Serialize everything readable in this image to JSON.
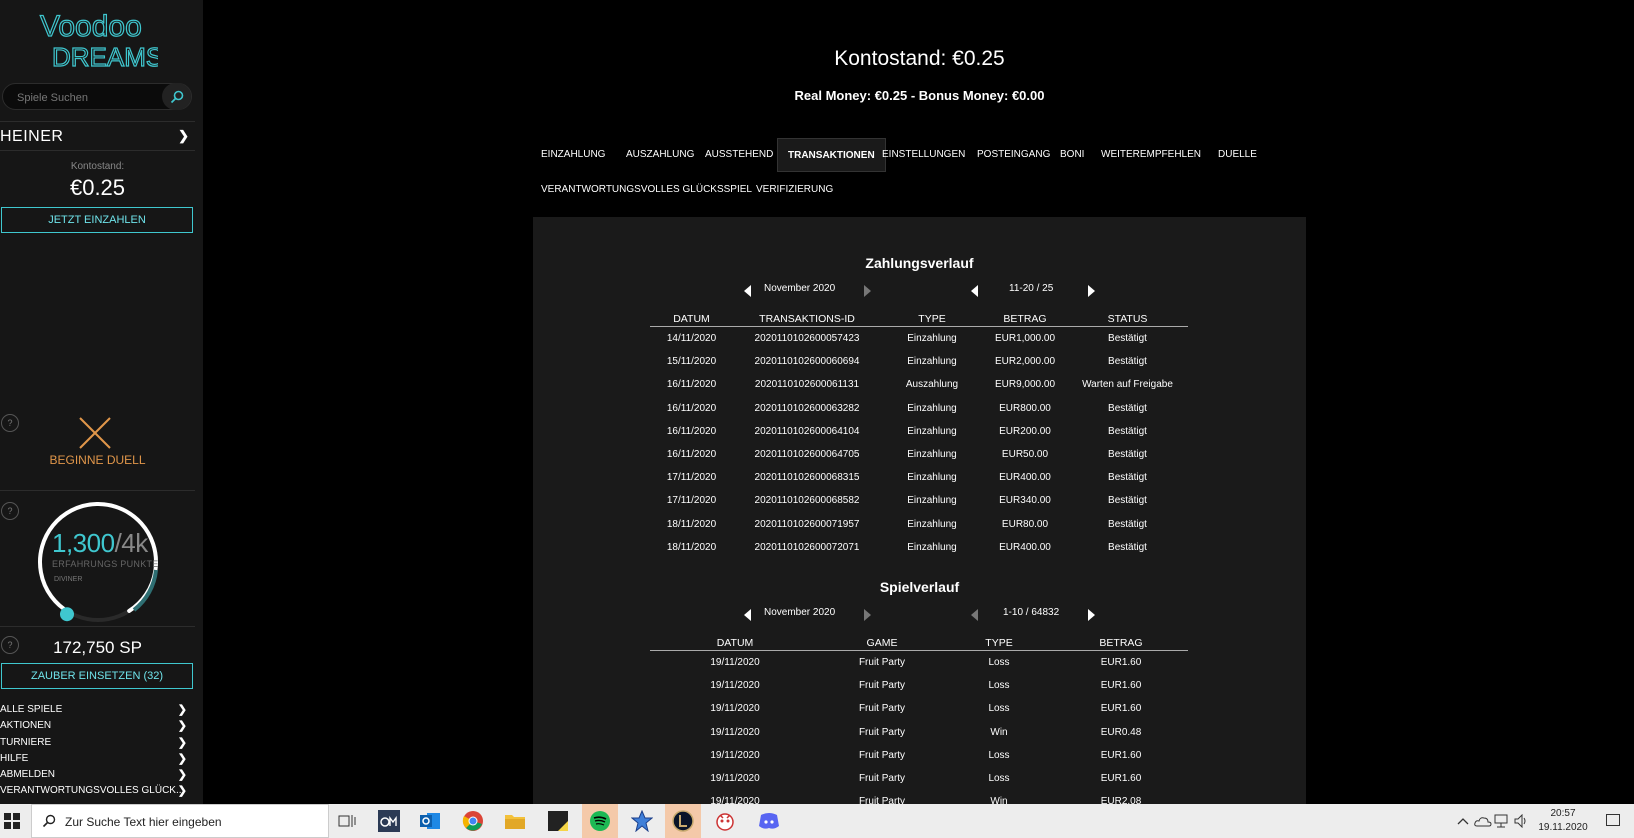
{
  "sidebar": {
    "logo_line1": "Voodoo",
    "logo_line2": "DREAMS",
    "search_placeholder": "Spiele Suchen",
    "username": "HEINER",
    "balance_label": "Kontostand:",
    "balance_value": "€0.25",
    "deposit_button": "JETZT EINZAHLEN",
    "help_mark": "?",
    "duel_label": "BEGINNE DUELL",
    "xp_current": "1,300",
    "xp_max": "/4k",
    "xp_label": "ERFAHRUNGS PUNKTE",
    "xp_rank": "DIVINER",
    "xp_progress": 0.325,
    "sp_value": "172,750 SP",
    "spells_button": "ZAUBER EINSETZEN (32)",
    "menu": [
      {
        "label": "ALLE SPIELE"
      },
      {
        "label": "AKTIONEN"
      },
      {
        "label": "TURNIERE"
      },
      {
        "label": "HILFE"
      },
      {
        "label": "ABMELDEN"
      },
      {
        "label": "VERANTWORTUNGSVOLLES GLÜCK..."
      }
    ]
  },
  "header": {
    "title": "Kontostand: €0.25",
    "subtitle": "Real Money: €0.25 - Bonus Money: €0.00"
  },
  "tabs": [
    {
      "label": "EINZAHLUNG"
    },
    {
      "label": "AUSZAHLUNG"
    },
    {
      "label": "AUSSTEHEND"
    },
    {
      "label": "TRANSAKTIONEN",
      "active": true
    },
    {
      "label": "EINSTELLUNGEN"
    },
    {
      "label": "POSTEINGANG"
    },
    {
      "label": "BONI"
    },
    {
      "label": "WEITEREMPFEHLEN"
    },
    {
      "label": "DUELLE"
    },
    {
      "label": "VERANTWORTUNGSVOLLES GLÜCKSSPIEL"
    },
    {
      "label": "VERIFIZIERUNG"
    }
  ],
  "payments": {
    "title": "Zahlungsverlauf",
    "month": "November 2020",
    "range": "11-20 / 25",
    "columns": [
      "DATUM",
      "TRANSAKTIONS-ID",
      "TYPE",
      "BETRAG",
      "STATUS"
    ],
    "rows": [
      [
        "14/11/2020",
        "20201101026000574 23",
        "Einzahlung",
        "EUR1,000.00",
        "Bestätigt"
      ],
      [
        "15/11/2020",
        "2020110102600060694",
        "Einzahlung",
        "EUR2,000.00",
        "Bestätigt"
      ],
      [
        "16/11/2020",
        "2020110102600061131",
        "Auszahlung",
        "EUR9,000.00",
        "Warten auf Freigabe"
      ],
      [
        "16/11/2020",
        "2020110102600063282",
        "Einzahlung",
        "EUR800.00",
        "Bestätigt"
      ],
      [
        "16/11/2020",
        "2020110102600064104",
        "Einzahlung",
        "EUR200.00",
        "Bestätigt"
      ],
      [
        "16/11/2020",
        "2020110102600064705",
        "Einzahlung",
        "EUR50.00",
        "Bestätigt"
      ],
      [
        "17/11/2020",
        "2020110102600068315",
        "Einzahlung",
        "EUR400.00",
        "Bestätigt"
      ],
      [
        "17/11/2020",
        "2020110102600068582",
        "Einzahlung",
        "EUR340.00",
        "Bestätigt"
      ],
      [
        "18/11/2020",
        "2020110102600071957",
        "Einzahlung",
        "EUR80.00",
        "Bestätigt"
      ],
      [
        "18/11/2020",
        "2020110102600072071",
        "Einzahlung",
        "EUR400.00",
        "Bestätigt"
      ]
    ]
  },
  "games": {
    "title": "Spielverlauf",
    "month": "November 2020",
    "range": "1-10 / 64832",
    "columns": [
      "DATUM",
      "GAME",
      "TYPE",
      "BETRAG"
    ],
    "rows": [
      [
        "19/11/2020",
        "Fruit Party",
        "Loss",
        "EUR1.60"
      ],
      [
        "19/11/2020",
        "Fruit Party",
        "Loss",
        "EUR1.60"
      ],
      [
        "19/11/2020",
        "Fruit Party",
        "Loss",
        "EUR1.60"
      ],
      [
        "19/11/2020",
        "Fruit Party",
        "Win",
        "EUR0.48"
      ],
      [
        "19/11/2020",
        "Fruit Party",
        "Loss",
        "EUR1.60"
      ],
      [
        "19/11/2020",
        "Fruit Party",
        "Loss",
        "EUR1.60"
      ],
      [
        "19/11/2020",
        "Fruit Party",
        "Win",
        "EUR2.08"
      ]
    ]
  },
  "taskbar": {
    "search_placeholder": "Zur Suche Text hier eingeben",
    "time": "20:57",
    "date": "19.11.2020"
  },
  "colors": {
    "accent": "#3fc7cf",
    "duel": "#e0964a",
    "panel": "#1a1a1a",
    "sidebar": "#161616"
  }
}
